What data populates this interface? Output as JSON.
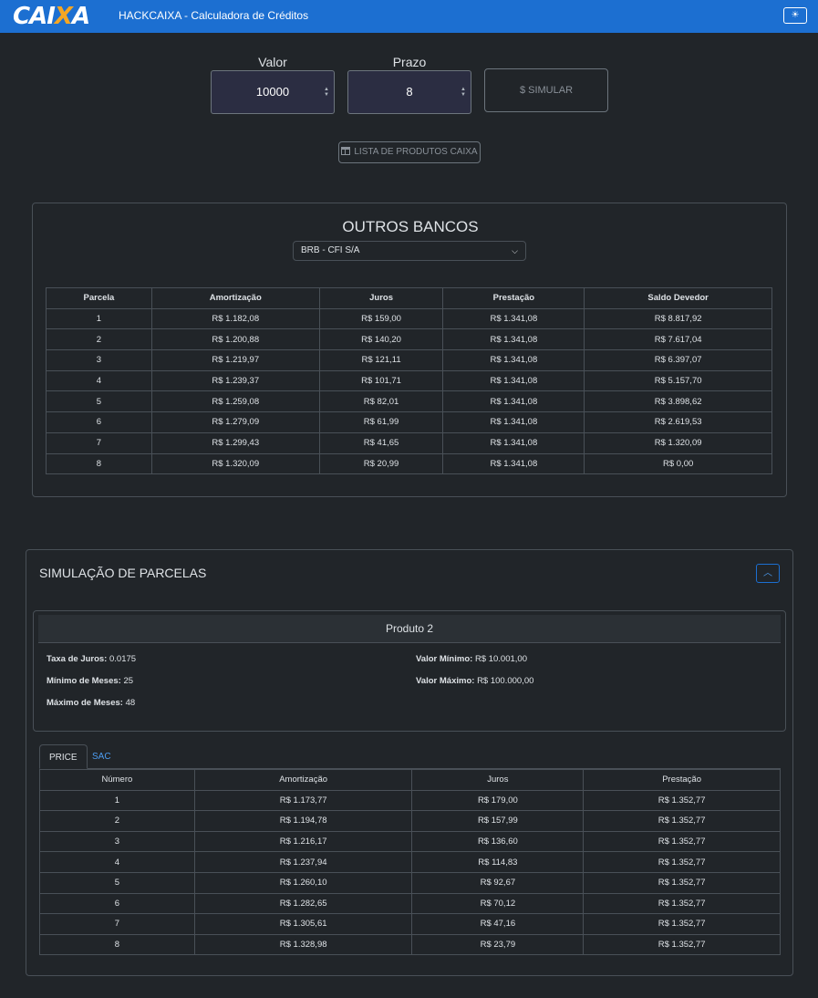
{
  "header": {
    "logo_left": "CAI",
    "logo_x": "X",
    "logo_right": "A",
    "title": "HACKCAIXA - Calculadora de Créditos",
    "theme_icon": "☀"
  },
  "form": {
    "valor_label": "Valor",
    "valor_value": "10000",
    "prazo_label": "Prazo",
    "prazo_value": "8",
    "simulate_label": "SIMULAR",
    "list_label": "LISTA DE PRODUTOS CAIXA"
  },
  "outros_bancos": {
    "title": "OUTROS BANCOS",
    "selected_bank": "BRB - CFI S/A",
    "columns": [
      "Parcela",
      "Amortização",
      "Juros",
      "Prestação",
      "Saldo Devedor"
    ],
    "rows": [
      [
        "1",
        "R$ 1.182,08",
        "R$ 159,00",
        "R$ 1.341,08",
        "R$ 8.817,92"
      ],
      [
        "2",
        "R$ 1.200,88",
        "R$ 140,20",
        "R$ 1.341,08",
        "R$ 7.617,04"
      ],
      [
        "3",
        "R$ 1.219,97",
        "R$ 121,11",
        "R$ 1.341,08",
        "R$ 6.397,07"
      ],
      [
        "4",
        "R$ 1.239,37",
        "R$ 101,71",
        "R$ 1.341,08",
        "R$ 5.157,70"
      ],
      [
        "5",
        "R$ 1.259,08",
        "R$ 82,01",
        "R$ 1.341,08",
        "R$ 3.898,62"
      ],
      [
        "6",
        "R$ 1.279,09",
        "R$ 61,99",
        "R$ 1.341,08",
        "R$ 2.619,53"
      ],
      [
        "7",
        "R$ 1.299,43",
        "R$ 41,65",
        "R$ 1.341,08",
        "R$ 1.320,09"
      ],
      [
        "8",
        "R$ 1.320,09",
        "R$ 20,99",
        "R$ 1.341,08",
        "R$ 0,00"
      ]
    ]
  },
  "simulacao": {
    "title": "SIMULAÇÃO DE PARCELAS",
    "collapse_icon": "︿",
    "product": {
      "name": "Produto 2",
      "taxa_label": "Taxa de Juros:",
      "taxa_value": "0.0175",
      "min_meses_label": "Mínimo de Meses:",
      "min_meses_value": "25",
      "max_meses_label": "Máximo de Meses:",
      "max_meses_value": "48",
      "valor_min_label": "Valor Mínimo:",
      "valor_min_value": "R$ 10.001,00",
      "valor_max_label": "Valor Máximo:",
      "valor_max_value": "R$ 100.000,00"
    },
    "tabs": [
      "PRICE",
      "SAC"
    ],
    "columns": [
      "Número",
      "Amortização",
      "Juros",
      "Prestação"
    ],
    "rows": [
      [
        "1",
        "R$ 1.173,77",
        "R$ 179,00",
        "R$ 1.352,77"
      ],
      [
        "2",
        "R$ 1.194,78",
        "R$ 157,99",
        "R$ 1.352,77"
      ],
      [
        "3",
        "R$ 1.216,17",
        "R$ 136,60",
        "R$ 1.352,77"
      ],
      [
        "4",
        "R$ 1.237,94",
        "R$ 114,83",
        "R$ 1.352,77"
      ],
      [
        "5",
        "R$ 1.260,10",
        "R$ 92,67",
        "R$ 1.352,77"
      ],
      [
        "6",
        "R$ 1.282,65",
        "R$ 70,12",
        "R$ 1.352,77"
      ],
      [
        "7",
        "R$ 1.305,61",
        "R$ 47,16",
        "R$ 1.352,77"
      ],
      [
        "8",
        "R$ 1.328,98",
        "R$ 23,79",
        "R$ 1.352,77"
      ]
    ]
  },
  "colors": {
    "navbar": "#1c6fd1",
    "background": "#212529",
    "accent_link": "#4d9cf0",
    "logo_x": "#f5a623"
  }
}
